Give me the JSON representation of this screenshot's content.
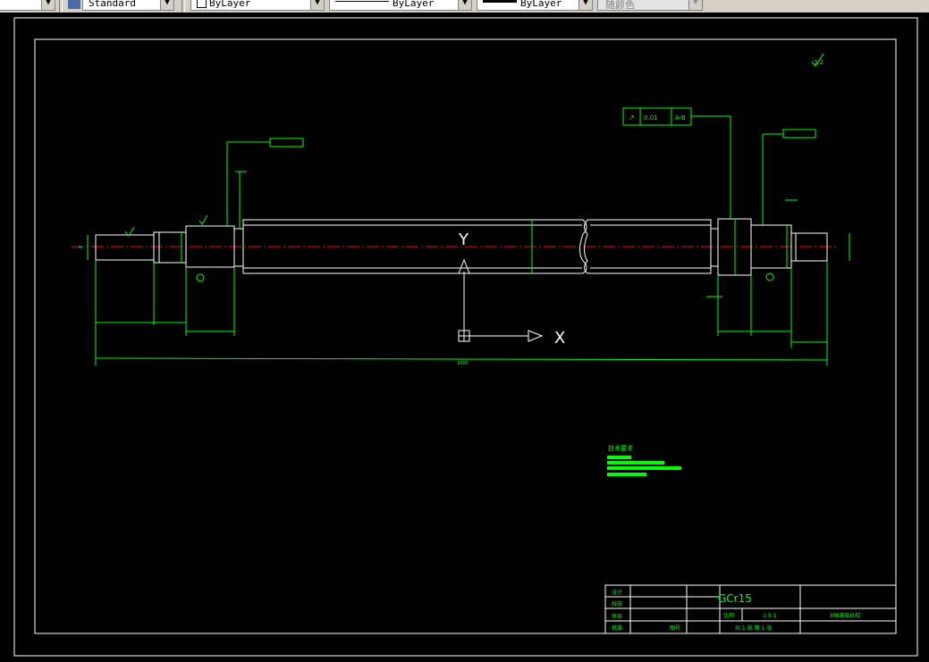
{
  "toolbar": {
    "style_value": "Standard",
    "color_value": "ByLayer",
    "linetype_value": "ByLayer",
    "lineweight_value": "ByLayer",
    "plotstyle_value": "随颜色"
  },
  "drawing": {
    "material": "GCr15",
    "scale": "1:5:1",
    "ucs_y": "Y",
    "ucs_x": "X",
    "title_block": {
      "design": "设计",
      "check": "校核",
      "review": "审核",
      "approve": "批准",
      "ratio_label": "比例",
      "part_no_label": "图号",
      "drawing_name": "X轴滚珠丝杠",
      "sheets": "共 1 张  第 1 张"
    },
    "tech_req_title": "技术要求",
    "tolerance_main": "0.01",
    "tolerance_datum": "A-B",
    "roughness_top": "3.2",
    "total_length": "1000"
  },
  "colors": {
    "line": "#00ff00",
    "center": "#ff0000",
    "part": "#ffffff"
  }
}
